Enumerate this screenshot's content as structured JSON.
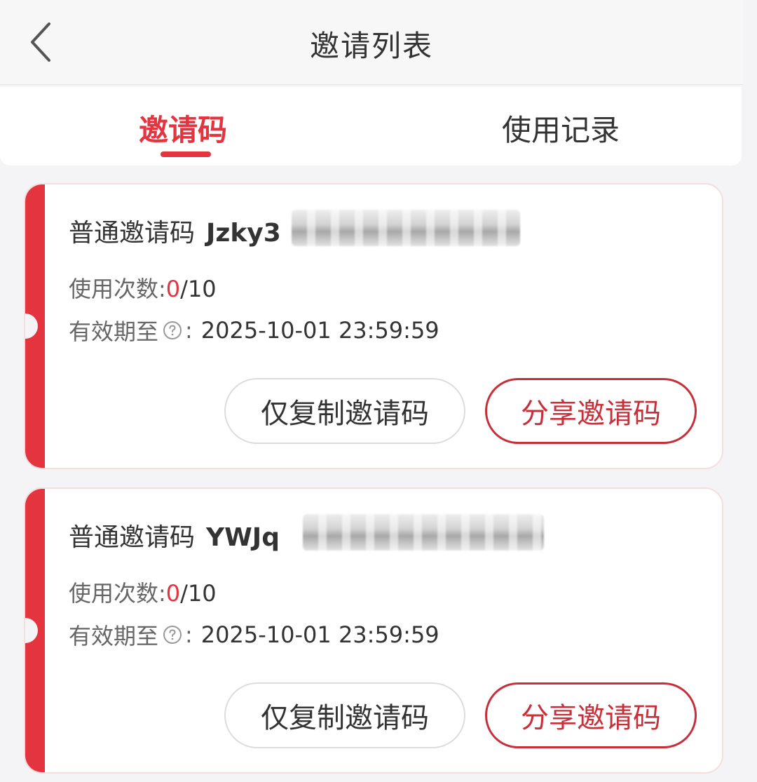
{
  "header": {
    "title": "邀请列表",
    "back_icon": "chevron-left-icon"
  },
  "tabs": [
    {
      "label": "邀请码",
      "active": true
    },
    {
      "label": "使用记录",
      "active": false
    }
  ],
  "colors": {
    "accent": "#e3343f",
    "share_button": "#c7303a"
  },
  "labels": {
    "usage_label": "使用次数:",
    "expire_label": "有效期至",
    "expire_colon": ":",
    "help_icon": "question-circle-icon",
    "copy_button": "仅复制邀请码",
    "share_button": "分享邀请码"
  },
  "cards": [
    {
      "type": "普通邀请码",
      "code_visible": "Jzky3",
      "used": "0",
      "total": "/10",
      "expire": "2025-10-01 23:59:59"
    },
    {
      "type": "普通邀请码",
      "code_visible": "YWJq",
      "used": "0",
      "total": "/10",
      "expire": "2025-10-01 23:59:59"
    }
  ]
}
